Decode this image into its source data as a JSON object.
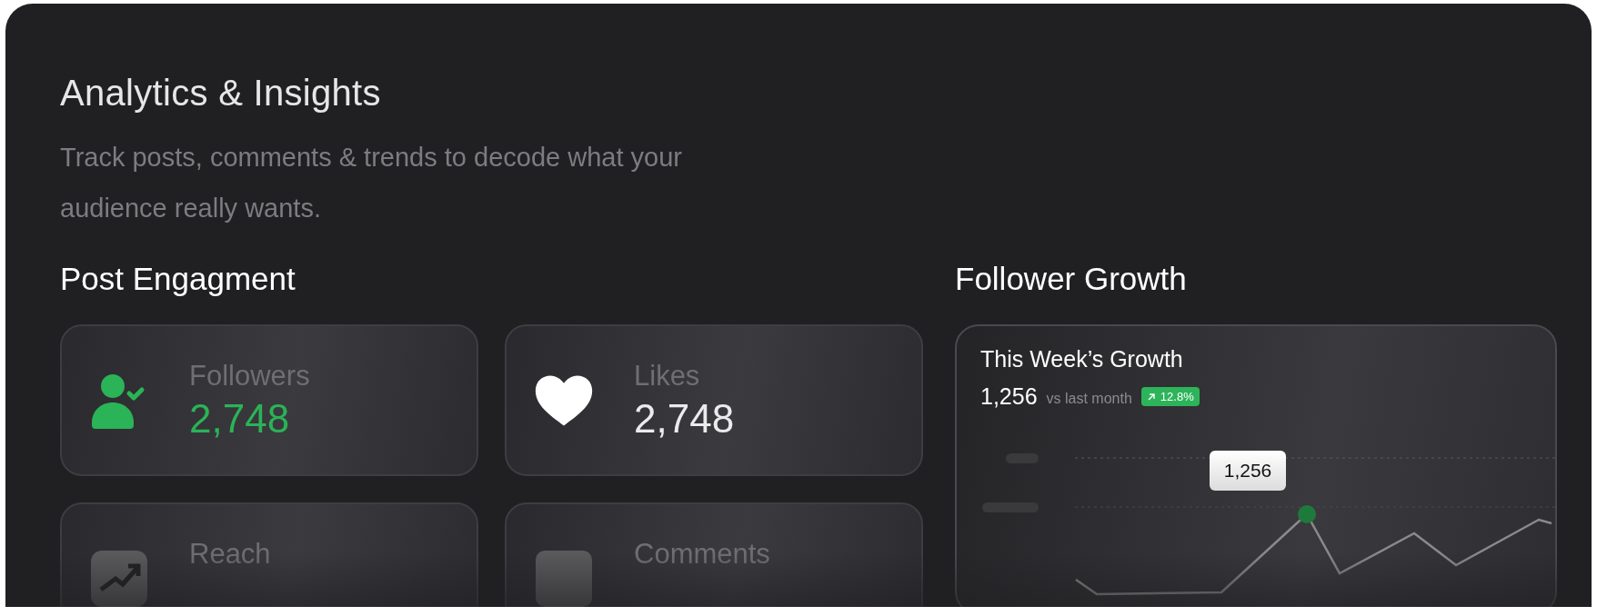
{
  "header": {
    "title": "Analytics & Insights",
    "subtitle": "Track posts, comments & trends to decode what your audience really wants."
  },
  "engagement": {
    "title": "Post Engagment",
    "cards": [
      {
        "kind": "followers",
        "label": "Followers",
        "value": "2,748",
        "selected": true
      },
      {
        "kind": "likes",
        "label": "Likes",
        "value": "2,748",
        "selected": false
      },
      {
        "kind": "reach",
        "label": "Reach",
        "selected": false
      },
      {
        "kind": "comments",
        "label": "Comments",
        "selected": false
      }
    ]
  },
  "growth": {
    "title": "Follower Growth",
    "card_title": "This Week’s Growth",
    "value": "1,256",
    "comparison": "vs last month",
    "change": "12.8%",
    "tooltip": "1,256"
  }
}
